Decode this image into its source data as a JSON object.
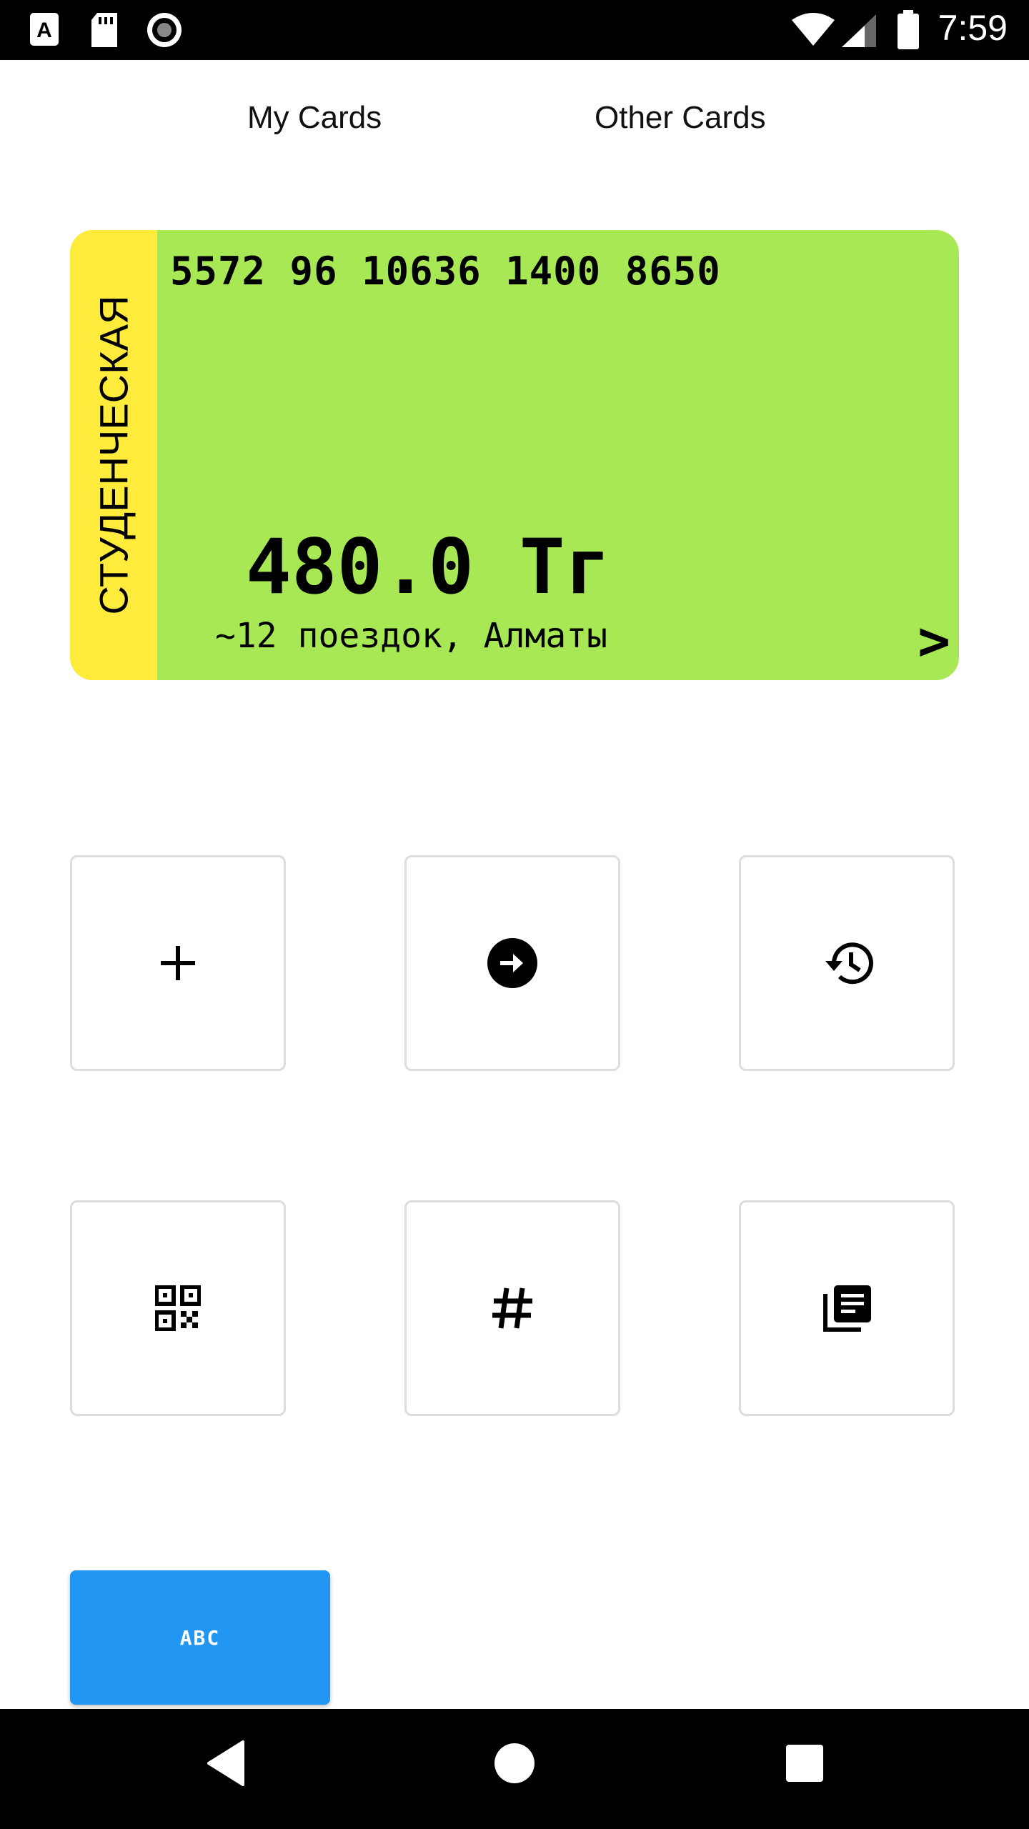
{
  "status_bar": {
    "time": "7:59",
    "icons": [
      "a-notification-icon",
      "sd-card-icon",
      "record-icon",
      "wifi-icon",
      "signal-icon",
      "battery-icon"
    ]
  },
  "tabs": {
    "my_cards": "My Cards",
    "other_cards": "Other Cards"
  },
  "card": {
    "type_label": "СТУДЕНЧЕСКАЯ",
    "number": "5572 96 10636 1400 8650",
    "balance": "480.0 Тг",
    "trips_info": "~12 поездок, Алматы",
    "arrow": ">",
    "colors": {
      "body": "#a8e855",
      "stripe": "#ffeb3b"
    }
  },
  "actions": [
    {
      "icon": "plus-icon"
    },
    {
      "icon": "arrow-right-circle-icon"
    },
    {
      "icon": "history-icon"
    },
    {
      "icon": "qr-code-icon"
    },
    {
      "icon": "hash-icon"
    },
    {
      "icon": "library-books-icon"
    }
  ],
  "abc_button": {
    "label": "ABC",
    "color": "#2196f3"
  },
  "nav_bar": {
    "icons": [
      "back-icon",
      "home-icon",
      "recents-icon"
    ]
  }
}
